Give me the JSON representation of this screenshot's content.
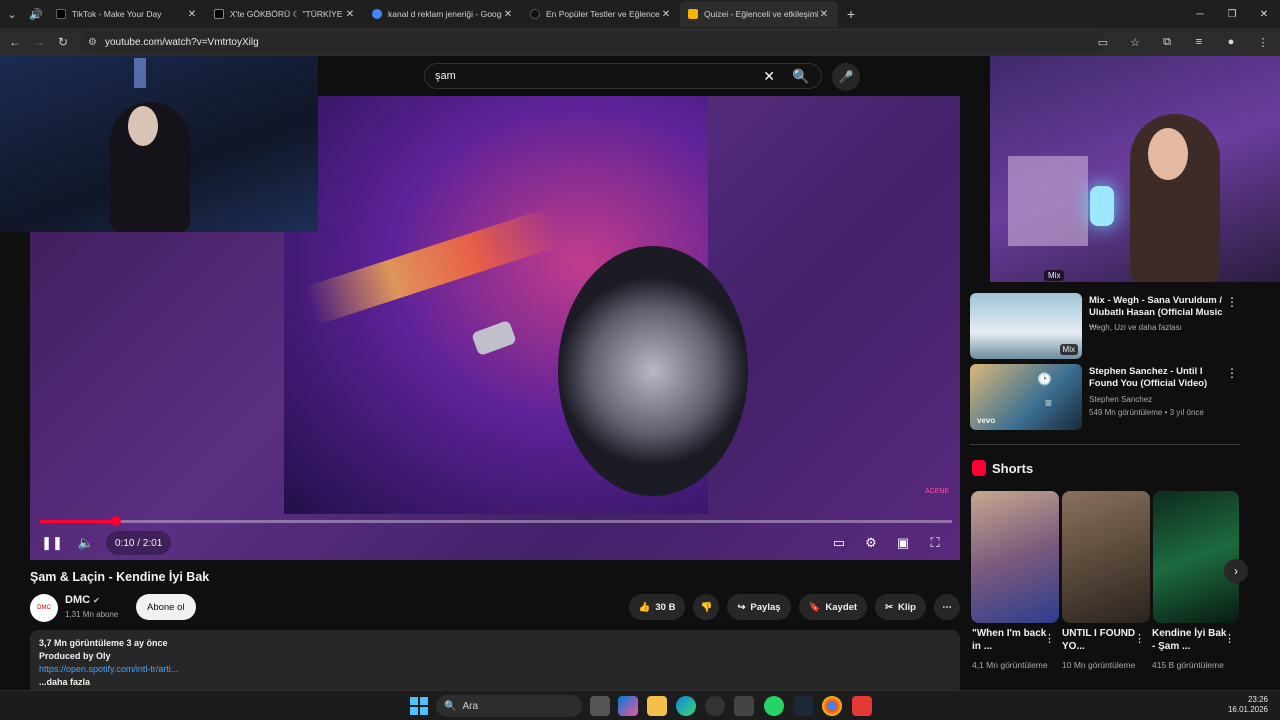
{
  "browser": {
    "tabs": [
      {
        "title": "TikTok - Make Your Day",
        "favcolor": "#000000"
      },
      {
        "title": "X'te GÖKBÖRÜ ☾ \"TÜRKİYE TÜ",
        "favcolor": "#000000"
      },
      {
        "title": "kanal d reklam jeneriği - Googl",
        "favcolor": "#4285f4"
      },
      {
        "title": "En Popüler Testler ve Eğlenceli",
        "favcolor": "#111111"
      },
      {
        "title": "Quizei - Eğlenceli ve etkileşimli",
        "favcolor": "#f4b400"
      }
    ],
    "url": "youtube.com/watch?v=VmtrtoyXilg",
    "new_tab": "+"
  },
  "search": {
    "query": "şam"
  },
  "player": {
    "time": "0:10 / 2:01",
    "progress_fraction": 0.083,
    "watermark": "ACENE"
  },
  "video": {
    "title": "Şam & Laçin - Kendine İyi Bak",
    "channel": "DMC",
    "channel_avatar_text": "DMC",
    "subscribers": "1,31 Mn abone",
    "subscribe_label": "Abone ol",
    "likes": "30 B",
    "share_label": "Paylaş",
    "save_label": "Kaydet",
    "clip_label": "Klip",
    "views_line": "3,7 Mn görüntüleme  3 ay önce",
    "produced": "Produced by Oly",
    "link": "https://open.spotify.com/intl-tr/arti...",
    "more": "...daha fazla"
  },
  "sidebar": {
    "mix_badge": "Mix",
    "recs": [
      {
        "title": "Mix - Wegh - Sana Vuruldum / Ulubatlı Hasan (Official Music ...",
        "sub": "Wegh, Uzi ve daha fazlası",
        "badge": "Mix"
      },
      {
        "title": "Stephen Sanchez - Until I Found You (Official Video)",
        "channel": "Stephen Sanchez",
        "sub": "549 Mn görüntüleme • 3 yıl önce",
        "thumb_label": "vevo"
      }
    ],
    "shorts_heading": "Shorts",
    "shorts": [
      {
        "title": "\"When I'm back in ...",
        "views": "4,1 Mn görüntüleme"
      },
      {
        "title": "UNTIL I FOUND YO...",
        "views": "10 Mn görüntüleme"
      },
      {
        "title": "Kendine İyi Bak - Şam ...",
        "views": "415 B görüntüleme"
      }
    ]
  },
  "taskbar": {
    "search_label": "Ara",
    "time": "23:26",
    "date": "16.01.2026"
  }
}
